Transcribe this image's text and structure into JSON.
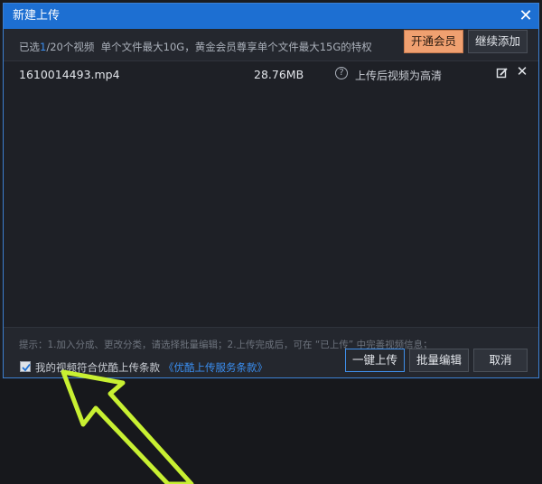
{
  "dialog": {
    "title": "新建上传",
    "close_icon": "close-icon"
  },
  "info": {
    "selected_prefix": "已选",
    "selected_count": "1",
    "selected_suffix": "/20个视频",
    "limits": "单个文件最大10G，黄金会员尊享单个文件最大15G的特权",
    "vip_button": "开通会员",
    "continue_button": "继续添加"
  },
  "files": [
    {
      "name": "1610014493.mp4",
      "size": "28.76MB",
      "quality_icon": "question-icon",
      "quality": "上传后视频为高清",
      "edit_icon": "edit-icon",
      "remove_icon": "close-icon"
    }
  ],
  "footer": {
    "tip": "提示：1.加入分成、更改分类，请选择批量编辑；2.上传完成后，可在 “已上传” 中完善视频信息；",
    "agree_checked": true,
    "agree_text": "我的视频符合优酷上传条款",
    "terms_link": "《优酷上传服务条款》",
    "upload_button": "一键上传",
    "batch_edit_button": "批量编辑",
    "cancel_button": "取消"
  },
  "colors": {
    "titlebar": "#1d6fd2",
    "accent_blue": "#3a8ef0",
    "vip_orange": "#f0a070",
    "arrow": "#c8f032"
  },
  "annotation": {
    "arrow_icon": "annotation-arrow-icon"
  }
}
